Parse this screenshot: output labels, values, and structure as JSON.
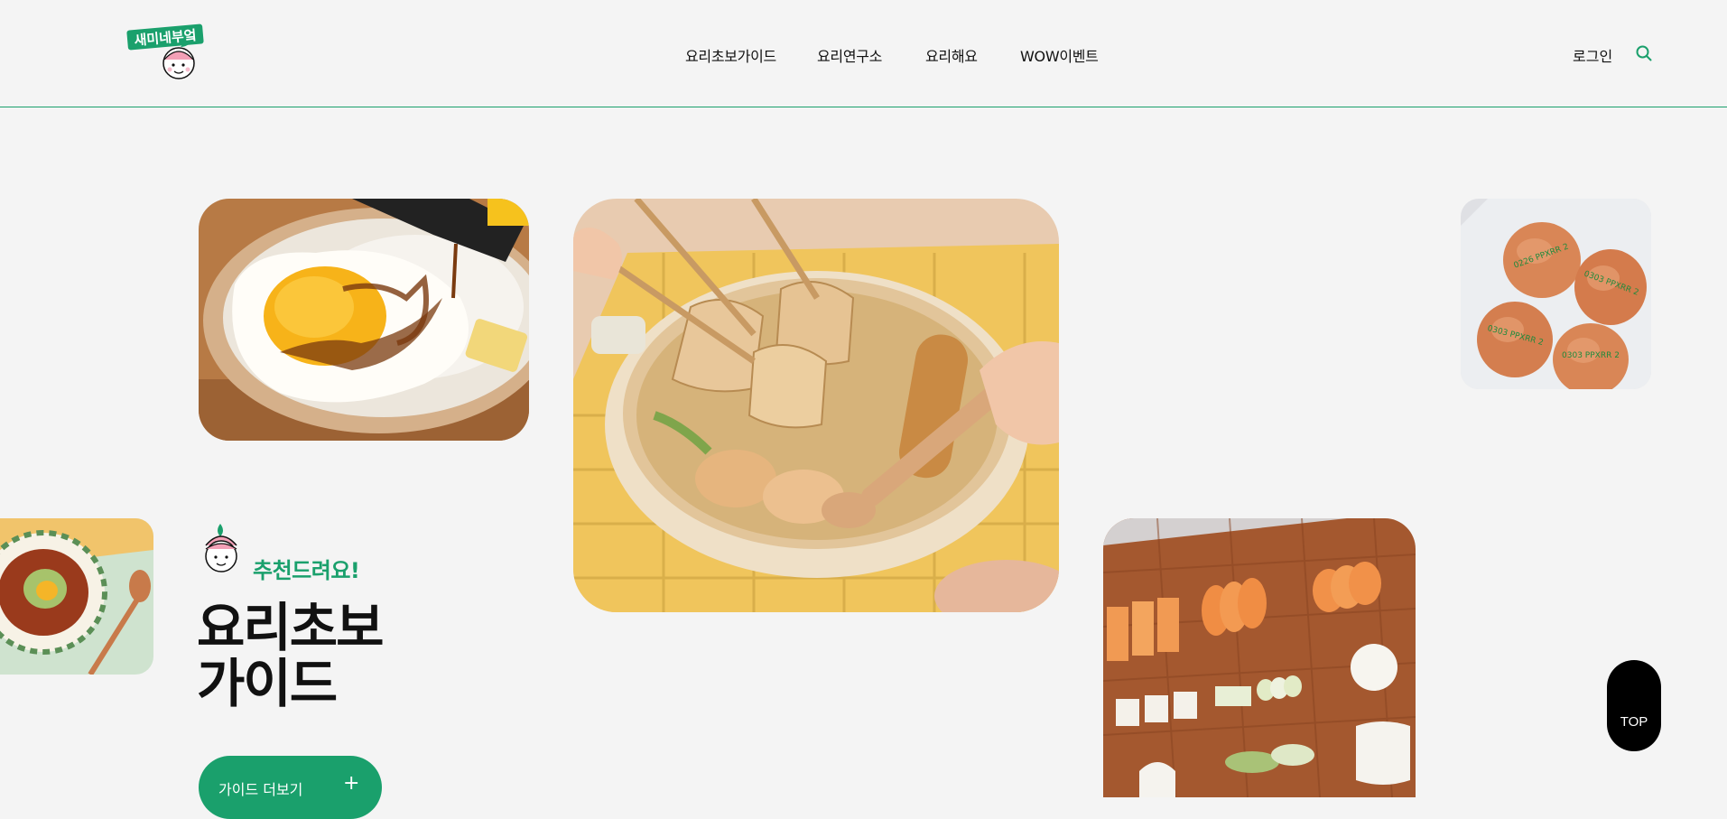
{
  "header": {
    "logo_alt": "새미네부엌",
    "nav": [
      {
        "label": "요리초보가이드"
      },
      {
        "label": "요리연구소"
      },
      {
        "label": "요리해요"
      },
      {
        "label": "WOW이벤트"
      }
    ],
    "login_label": "로그인",
    "search_icon": "search-icon"
  },
  "hero": {
    "recommend_label": "추천드려요!",
    "title_line1": "요리초보",
    "title_line2": "가이드",
    "cta_label": "가이드 더보기",
    "cta_icon": "plus-icon"
  },
  "photos": [
    {
      "name": "fried-egg-rice-bowl-photo"
    },
    {
      "name": "fishcake-soup-photo"
    },
    {
      "name": "eggs-carton-photo"
    },
    {
      "name": "bibimbap-bowl-photo"
    },
    {
      "name": "sliced-vegetables-photo"
    }
  ],
  "egg_stamps": [
    "0226 PPXRR 2",
    "0303 PPXRR 2",
    "0303 PPXRR 2",
    "0303 PPXRR 2"
  ],
  "top_button_label": "TOP",
  "colors": {
    "brand_green": "#1aa06c",
    "background": "#f4f4f4",
    "text": "#111111"
  }
}
